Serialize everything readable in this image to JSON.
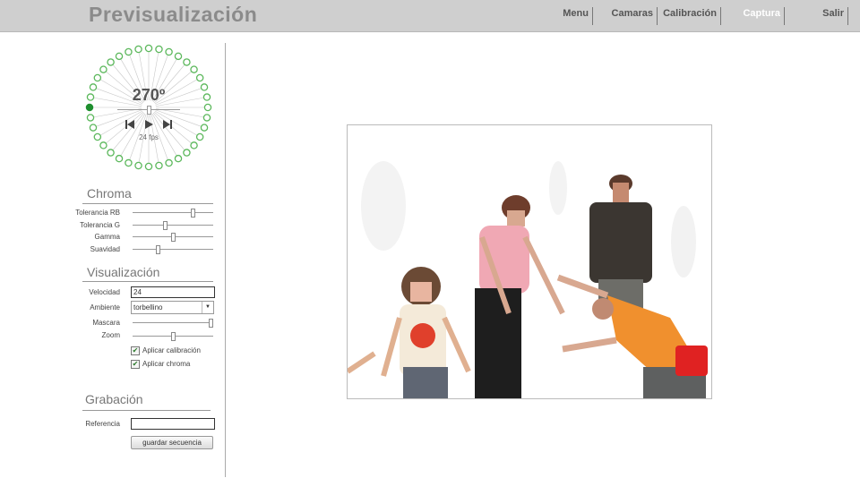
{
  "header": {
    "title": "Previsualización",
    "nav": [
      {
        "label": "Menu",
        "active": false
      },
      {
        "label": "Camaras",
        "active": false
      },
      {
        "label": "Calibración",
        "active": false
      },
      {
        "label": "Captura",
        "active": true
      },
      {
        "label": "Salir",
        "active": false
      }
    ]
  },
  "dial": {
    "angle": "270º",
    "fps": "24 fps",
    "camera_count": 36,
    "selected_camera_index": 27,
    "colors": {
      "ring": "#5cb85c",
      "selected": "#1f8f2f",
      "spokes": "#c8c8c8"
    }
  },
  "chroma": {
    "title": "Chroma",
    "sliders": [
      {
        "label": "Tolerancia RB",
        "value": 0.76
      },
      {
        "label": "Tolerancia G",
        "value": 0.4
      },
      {
        "label": "Gamma",
        "value": 0.5
      },
      {
        "label": "Suavidad",
        "value": 0.3
      }
    ]
  },
  "visualizacion": {
    "title": "Visualización",
    "velocidad_label": "Velocidad",
    "velocidad_value": "24",
    "ambiente_label": "Ambiente",
    "ambiente_value": "torbellino",
    "mascara_label": "Mascara",
    "mascara_value": 1.0,
    "zoom_label": "Zoom",
    "zoom_value": 0.5,
    "aplicar_calibracion_label": "Aplicar calibración",
    "aplicar_calibracion_checked": true,
    "aplicar_chroma_label": "Aplicar chroma",
    "aplicar_chroma_checked": true
  },
  "grabacion": {
    "title": "Grabación",
    "referencia_label": "Referencia",
    "referencia_value": "",
    "save_button": "guardar secuencia"
  }
}
